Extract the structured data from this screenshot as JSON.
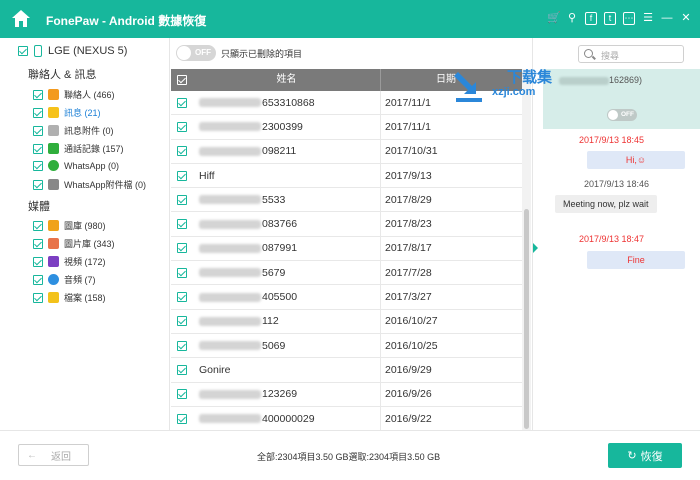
{
  "app": {
    "title": "FonePaw - Android 數據恢復"
  },
  "titlebar_icons": [
    "cart-icon",
    "key-icon",
    "facebook-icon",
    "twitter-icon",
    "feedback-icon",
    "menu-icon",
    "minimize-icon",
    "close-icon"
  ],
  "sidebar": {
    "device": "LGE (NEXUS 5)",
    "groups": [
      {
        "title": "聯絡人 & 訊息",
        "items": [
          {
            "label": "聯絡人 (466)",
            "icon": "contacts-icon",
            "color": "#f39a1e",
            "active": false
          },
          {
            "label": "訊息 (21)",
            "icon": "message-icon",
            "color": "#f6c21b",
            "active": true
          },
          {
            "label": "訊息附件 (0)",
            "icon": "message-attachment-icon",
            "color": "#b0b0b0",
            "active": false
          },
          {
            "label": "通話記錄 (157)",
            "icon": "call-log-icon",
            "color": "#2fae3c",
            "active": false
          },
          {
            "label": "WhatsApp (0)",
            "icon": "whatsapp-icon",
            "color": "#2fae3c",
            "active": false
          },
          {
            "label": "WhatsApp附件檔 (0)",
            "icon": "whatsapp-attachment-icon",
            "color": "#888888",
            "active": false
          }
        ]
      },
      {
        "title": "媒體",
        "items": [
          {
            "label": "圖庫 (980)",
            "icon": "gallery-icon",
            "color": "#f0a21a",
            "active": false
          },
          {
            "label": "圖片庫 (343)",
            "icon": "picture-library-icon",
            "color": "#e8734a",
            "active": false
          },
          {
            "label": "視頻 (172)",
            "icon": "video-icon",
            "color": "#7c3fc2",
            "active": false
          },
          {
            "label": "音頻 (7)",
            "icon": "audio-icon",
            "color": "#2d8fe0",
            "active": false
          },
          {
            "label": "檔案 (158)",
            "icon": "folder-icon",
            "color": "#f3c21b",
            "active": false
          }
        ]
      }
    ]
  },
  "filter": {
    "toggle": "OFF",
    "label": "只顯示已刪除的項目"
  },
  "table": {
    "headers": {
      "name": "姓名",
      "date": "日期"
    },
    "rows": [
      {
        "name": "653310868",
        "blurred": true,
        "date": "2017/11/1"
      },
      {
        "name": "2300399",
        "blurred": true,
        "date": "2017/11/1"
      },
      {
        "name": "098211",
        "blurred": true,
        "date": "2017/10/31"
      },
      {
        "name": "Hiff",
        "blurred": false,
        "date": "2017/9/13"
      },
      {
        "name": "5533",
        "blurred": true,
        "date": "2017/8/29"
      },
      {
        "name": "083766",
        "blurred": true,
        "date": "2017/8/23"
      },
      {
        "name": "087991",
        "blurred": true,
        "date": "2017/8/17"
      },
      {
        "name": "5679",
        "blurred": true,
        "date": "2017/7/28"
      },
      {
        "name": "405500",
        "blurred": true,
        "date": "2017/3/27"
      },
      {
        "name": "112",
        "blurred": true,
        "date": "2016/10/27"
      },
      {
        "name": "5069",
        "blurred": true,
        "date": "2016/10/25"
      },
      {
        "name": "Gonire",
        "blurred": false,
        "date": "2016/9/29"
      },
      {
        "name": "123269",
        "blurred": true,
        "date": "2016/9/26"
      },
      {
        "name": "400000029",
        "blurred": true,
        "date": "2016/9/22"
      }
    ]
  },
  "detail": {
    "search_placeholder": "搜尋",
    "contact_suffix": "162869)",
    "contact_toggle": "OFF",
    "messages": [
      {
        "time": "2017/9/13 18:45",
        "text": "Hi,☺",
        "direction": "out"
      },
      {
        "time": "2017/9/13 18:46",
        "text": "Meeting now, plz wait",
        "direction": "in"
      },
      {
        "time": "2017/9/13 18:47",
        "text": "Fine",
        "direction": "out"
      }
    ]
  },
  "watermark": {
    "line1": "下载集",
    "line2": "xzji.com"
  },
  "footer": {
    "back_label": "返回",
    "stats": "全部:2304項目3.50 GB選取:2304項目3.50 GB",
    "recover_label": "恢復"
  },
  "colors": {
    "accent": "#17b79c",
    "link": "#1a7fd6",
    "alert": "#e33333"
  }
}
